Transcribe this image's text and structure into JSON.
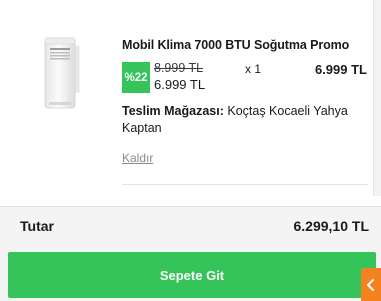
{
  "cart_item": {
    "product_title": "Mobil Klima 7000 BTU Soğutma Promo",
    "image_icon": "portable-air-conditioner",
    "discount_badge": "%22",
    "old_price": "8.999 TL",
    "new_price": "6.999 TL",
    "quantity": "x 1",
    "line_total": "6.999 TL",
    "store_label": "Teslim Mağazası:",
    "store_name": "Koçtaş Kocaeli Yahya Kaptan",
    "remove_label": "Kaldır"
  },
  "summary": {
    "total_label": "Tutar",
    "total_value": "6.299,10 TL",
    "checkout_label": "Sepete Git"
  },
  "side_tab": {
    "icon": "chevron-left-icon"
  },
  "colors": {
    "accent_green": "#35c45a",
    "side_tab_orange": "#f58220",
    "summary_background": "#f4f4f4"
  }
}
